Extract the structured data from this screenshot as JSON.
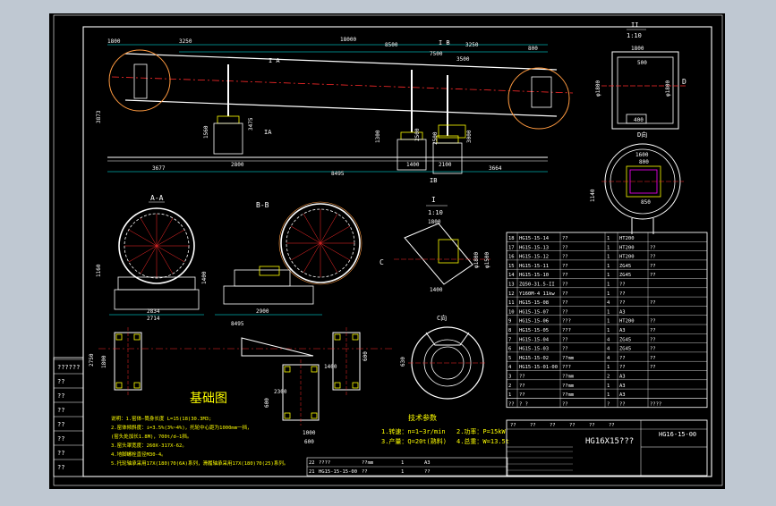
{
  "colors": {
    "app_bg": "#bfc8d2",
    "sheet": "#000000",
    "frame": "#ffffff",
    "drum": "#ffffff",
    "dim": "#00ffff",
    "center": "#ff2a2a",
    "accent": "#ffff00",
    "magenta": "#ff00ff",
    "circle": "#ff9a40"
  },
  "drawing": {
    "main": {
      "view_1": "I A",
      "view_2": "I B",
      "section_ia": "IA",
      "section_ib": "IB"
    },
    "dims": {
      "top": [
        "1800",
        "3250",
        "18000",
        "8500",
        "3250",
        "800",
        "7500",
        "3500"
      ],
      "vertical": [
        "3873",
        "1560",
        "3475",
        "1300",
        "2500",
        "3000",
        "2500"
      ],
      "bottom": [
        "3677",
        "2800",
        "8495",
        "1400",
        "2100",
        "3664"
      ]
    },
    "detail_ii": {
      "label": "II",
      "scale": "1:10",
      "dims": [
        "1800",
        "φ1800",
        "φ1800",
        "500",
        "400",
        "D"
      ]
    },
    "detail_d": {
      "label": "D向",
      "dims": [
        "1600",
        "800",
        "850",
        "1140"
      ]
    },
    "section_aa": {
      "label": "A-A",
      "dims": [
        "1160",
        "2834",
        "2714"
      ]
    },
    "section_bb": {
      "label": "B-B",
      "dims": [
        "1400",
        "2900",
        "8495"
      ]
    },
    "detail_i": {
      "label": "I",
      "scale": "1:10",
      "dims": [
        "1800",
        "1400",
        "φ1800",
        "φ1500",
        "C"
      ]
    },
    "detail_c": {
      "label": "C向",
      "dims": [
        "630"
      ]
    },
    "foundation": {
      "title": "基础图",
      "dims": [
        "2750",
        "1800",
        "1400",
        "600",
        "2300",
        "1000",
        "600",
        "600"
      ]
    },
    "notes": [
      "说明：1.窑体—筒身长度 L=15(18)30.3M3;",
      "2.窑体倾斜度：i=3.5%(3%~4%)，托轮中心距为1000mm一挡，",
      "(窑头处加长1.8M)，700t/d—1挡。",
      "3.窑头罩宽度：260X-317X-62。",
      "4.地脚螺栓直径M30-4。",
      "5.托轮轴承采用17X(180)70(6A)系列，滑履轴承采用17X(180)70(25)系列。"
    ],
    "tech_params": {
      "title": "技术参数",
      "items": [
        "1.转速：n=1~3r/min",
        "2.功率：P=15kW",
        "3.产量：Q=20t(熟料)",
        "4.总重：W=13.5t"
      ]
    },
    "bom": {
      "rows": [
        [
          "18",
          "HG15-15-14",
          "??",
          "1",
          "HT200",
          ""
        ],
        [
          "17",
          "HG15-15-13",
          "??",
          "1",
          "HT200",
          "??"
        ],
        [
          "16",
          "HG15-15-12",
          "??",
          "1",
          "HT200",
          "??"
        ],
        [
          "15",
          "HG15-15-11",
          "??",
          "1",
          "ZG45",
          "??"
        ],
        [
          "14",
          "HG15-15-10",
          "??",
          "1",
          "ZG45",
          "??"
        ],
        [
          "13",
          "ZQ50-31.5-II",
          "??",
          "1",
          "??",
          ""
        ],
        [
          "12",
          "Y160M-4 11kw",
          "??",
          "1",
          "??",
          ""
        ],
        [
          "11",
          "HG15-15-08",
          "??",
          "4",
          "??",
          "??"
        ],
        [
          "10",
          "HG15-15-07",
          "??",
          "1",
          "A3",
          ""
        ],
        [
          "9",
          "HG15-15-06",
          "???",
          "1",
          "HT200",
          "??"
        ],
        [
          "8",
          "HG15-15-05",
          "???",
          "1",
          "A3",
          "??"
        ],
        [
          "7",
          "HG15-15-04",
          "??",
          "4",
          "ZG45",
          "??"
        ],
        [
          "6",
          "HG15-15-03",
          "??",
          "4",
          "ZG45",
          "??"
        ],
        [
          "5",
          "HG15-15-02",
          "??mm",
          "4",
          "??",
          "??"
        ],
        [
          "4",
          "HG15-15-01-00",
          "???",
          "1",
          "??",
          "??"
        ],
        [
          "3",
          "??",
          "??mm",
          "2",
          "A3",
          ""
        ],
        [
          "2",
          "??",
          "??mm",
          "1",
          "A3",
          ""
        ],
        [
          "1",
          "??",
          "??mm",
          "1",
          "A3",
          ""
        ]
      ],
      "header": [
        "??",
        "?  ?",
        "??",
        "?",
        "??",
        "????"
      ],
      "extra_rows": [
        [
          "22",
          "????",
          "??mm",
          "1",
          "A3",
          ""
        ],
        [
          "21",
          "HG15-15-15-00",
          "??",
          "1",
          "??",
          ""
        ]
      ]
    },
    "left_margin": [
      "??????",
      "??",
      "??",
      "??",
      "??",
      "??",
      "??",
      "??"
    ],
    "title_block": {
      "drawing_no": "HG16-15-00",
      "title": "HG16X15???",
      "sub": [
        "??",
        "??",
        "??",
        "??",
        "??",
        "??"
      ]
    }
  }
}
